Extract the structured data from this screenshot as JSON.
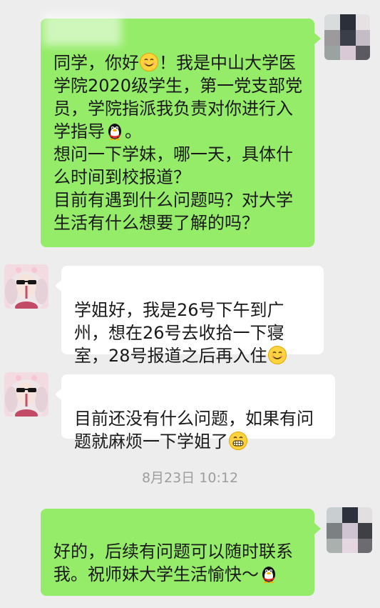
{
  "messages": [
    {
      "sender": "me",
      "text_main": "同学，你好",
      "text_after_smile": "！我是中山大学医学院2020级学生，第一党支部党员，学院指派我负责对你进行入学指导",
      "text_after_penguin": "。\n想问一下学妹，哪一天，具体什么时间到校报道？\n目前有遇到什么问题吗？对大学生活有什么想要了解的吗？",
      "emojis": [
        "smile-emoji",
        "qq-penguin-emoji"
      ]
    },
    {
      "sender": "other",
      "text": "学姐好，我是26号下午到广州，想在26号去收拾一下寝室，28号报道之后再入住",
      "emojis": [
        "smile-emoji"
      ]
    },
    {
      "sender": "other",
      "text": "目前还没有什么问题，如果有问题就麻烦一下学姐了",
      "emojis": [
        "grin-emoji"
      ]
    },
    {
      "sender": "me",
      "text": "好的，后续有问题可以随时联系我。祝师妹大学生活愉快～",
      "emojis": [
        "qq-penguin-emoji"
      ]
    }
  ],
  "timestamp": "8月23日 10:12",
  "colors": {
    "background": "#ededed",
    "outgoing_bubble": "#95ec69",
    "incoming_bubble": "#ffffff",
    "timestamp_text": "#9d9d9d"
  }
}
